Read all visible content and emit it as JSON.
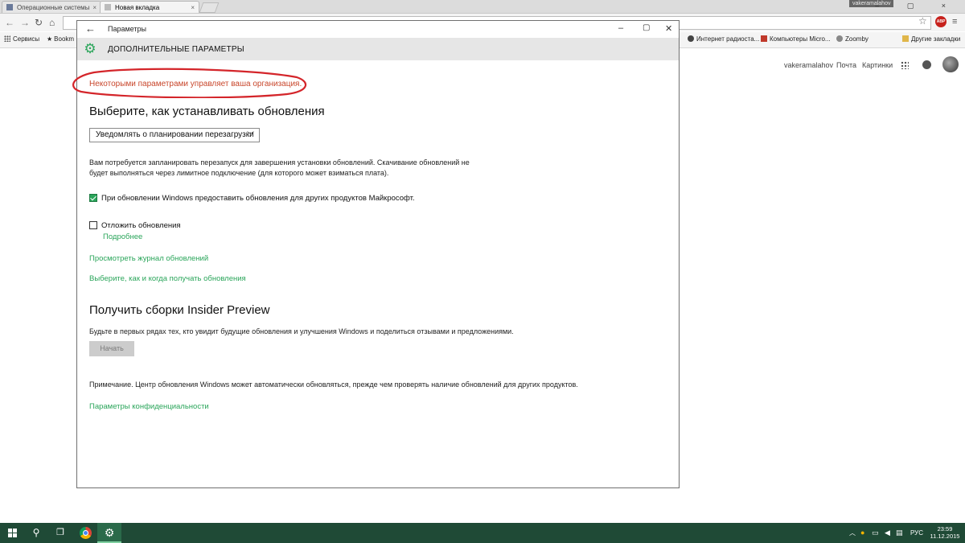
{
  "browser": {
    "tabs": [
      {
        "label": "Операционные системы",
        "close": "×"
      },
      {
        "label": "Новая вкладка",
        "close": "×"
      }
    ],
    "user": "vakeramalahov",
    "window_controls": "– ▢ ×",
    "abp_label": "ABP",
    "bookmarks": [
      {
        "label": "Сервисы",
        "icon": "apps-icon"
      },
      {
        "label": "Bookm",
        "icon": "star-icon"
      },
      {
        "label": "Интернет радиоста...",
        "icon": "radio-icon"
      },
      {
        "label": "Компьютеры Micro...",
        "icon": "computer-icon"
      },
      {
        "label": "Zoomby",
        "icon": "zoomby-icon"
      },
      {
        "label": "Другие закладки",
        "icon": "folder-icon"
      }
    ],
    "google_links": {
      "user": "vakeramalahov",
      "mail": "Почта",
      "images": "Картинки"
    }
  },
  "settings": {
    "window_title": "Параметры",
    "header_title": "ДОПОЛНИТЕЛЬНЫЕ ПАРАМЕТРЫ",
    "org_warning": "Некоторыми параметрами управляет ваша организация.",
    "section1_title": "Выберите, как устанавливать обновления",
    "install_mode_selected": "Уведомлять о планировании перезагрузки",
    "restart_note_line1": "Вам потребуется запланировать перезапуск для завершения установки обновлений. Скачивание обновлений не",
    "restart_note_line2": "будет выполняться через лимитное подключение (для которого может взиматься плата).",
    "share_updates_label": "При обновлении Windows предоставить обновления для других продуктов Майкрософт.",
    "share_updates_checked": true,
    "defer_updates_label": "Отложить обновления",
    "defer_updates_checked": false,
    "more_info_link": "Подробнее",
    "history_link": "Просмотреть журнал обновлений",
    "delivery_link": "Выберите, как и когда получать обновления",
    "section2_title": "Получить сборки Insider Preview",
    "insider_desc": "Будьте в первых рядах тех, кто увидит будущие обновления и улучшения Windows и поделиться отзывами и предложениями.",
    "start_button": "Начать",
    "note_text": "Примечание. Центр обновления Windows может автоматически обновляться, прежде чем проверять наличие обновлений для других продуктов.",
    "privacy_link": "Параметры конфиденциальности",
    "accent_color": "#2aa55a",
    "warning_color": "#c8462b"
  },
  "taskbar": {
    "language": "РУС",
    "time": "23:59",
    "date": "11.12.2015"
  }
}
